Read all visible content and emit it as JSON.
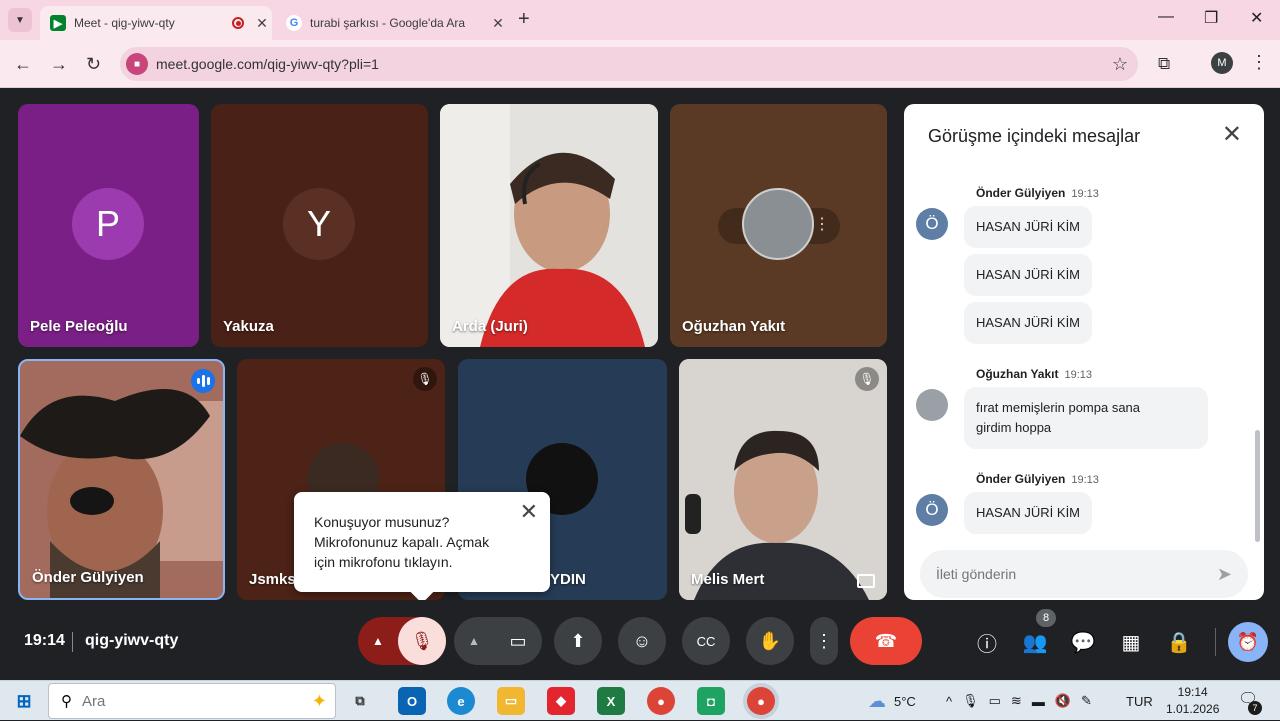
{
  "browser": {
    "tabs": [
      {
        "title": "Meet - qig-yiwv-qty",
        "favicon": "meet-icon"
      },
      {
        "title": "turabi şarkısı - Google'da Ara",
        "favicon": "google-icon"
      }
    ],
    "url": "meet.google.com/qig-yiwv-qty?pli=1",
    "profile_initial": "M"
  },
  "participants": [
    {
      "name": "Pele Peleoğlu",
      "initial": "P"
    },
    {
      "name": "Yakuza",
      "initial": "Y"
    },
    {
      "name": "Arda (Juri)"
    },
    {
      "name": "Oğuzhan Yakıt"
    },
    {
      "name": "Önder Gülyiyen"
    },
    {
      "name": "Jsmks"
    },
    {
      "name": "YDIN"
    },
    {
      "name": "Melis Mert"
    }
  ],
  "tooltip": {
    "line1": "Konuşuyor musunuz?",
    "line2": "Mikrofonunuz kapalı. Açmak",
    "line3": "için mikrofonu tıklayın."
  },
  "chat": {
    "title": "Görüşme içindeki mesajlar",
    "messages": [
      {
        "sender": "Önder Gülyiyen",
        "time": "19:13",
        "avatar": "Ö",
        "texts": [
          "HASAN JÜRİ KİM",
          "HASAN JÜRİ KİM",
          "HASAN JÜRİ KİM"
        ]
      },
      {
        "sender": "Oğuzhan Yakıt",
        "time": "19:13",
        "texts": [
          "fırat memişlerin pompa sana",
          "girdim hoppa"
        ]
      },
      {
        "sender": "Önder Gülyiyen",
        "time": "19:13",
        "avatar": "Ö",
        "texts": [
          "HASAN JÜRİ KİM"
        ]
      }
    ],
    "input_placeholder": "İleti gönderin"
  },
  "meeting": {
    "time": "19:14",
    "code": "qig-yiwv-qty",
    "participant_count": "8"
  },
  "taskbar": {
    "search_placeholder": "Ara",
    "weather": "5°C",
    "language": "TUR",
    "time": "19:14",
    "date": "1.01.2026",
    "notification_count": "7"
  },
  "colors": {
    "accent": "#1a73e8",
    "end_call": "#ea4335",
    "mic_off_bg": "#f9dedc",
    "tab_strip": "#f6d7e3"
  }
}
